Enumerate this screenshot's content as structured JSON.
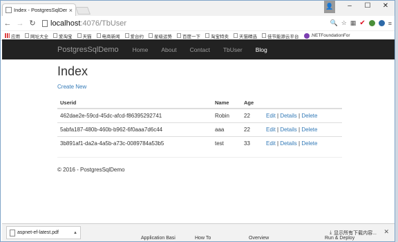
{
  "browser": {
    "tab_title": "Index - PostgresSqlDemo",
    "address_host": "localhost",
    "address_path": ":4076/TbUser",
    "window_controls": {
      "minimize": "–",
      "maximize": "☐",
      "close": "✕"
    },
    "bookmarks": [
      "应用",
      "网址大全",
      "爱淘宝",
      "天猫",
      "电商新闻",
      "爱台约",
      "星级运势",
      "百度一下",
      "淘宝特卖",
      "天猫精选",
      "佳节能源云平台",
      ".NETFoundationFor"
    ]
  },
  "site": {
    "brand": "PostgresSqlDemo",
    "nav": [
      "Home",
      "About",
      "Contact",
      "TbUser",
      "Blog"
    ],
    "active_nav": "Blog"
  },
  "main": {
    "heading": "Index",
    "create_link": "Create New",
    "table": {
      "headers": [
        "Userid",
        "Name",
        "Age",
        ""
      ],
      "rows": [
        {
          "id": "462dae2e-59cd-45dc-afcd-f86395292741",
          "name": "Robin",
          "age": "22"
        },
        {
          "id": "5abfa187-480b-460b-b962-6f0aaa7d6c44",
          "name": "aaa",
          "age": "22"
        },
        {
          "id": "3b891af1-da2a-4a5b-a73c-0089784a53b5",
          "name": "test",
          "age": "33"
        }
      ],
      "actions": {
        "edit": "Edit",
        "details": "Details",
        "delete": "Delete",
        "separator": "|"
      }
    },
    "footer": "© 2016 - PostgresSqlDemo"
  },
  "downloads": {
    "file": "aspnet-ef-latest.pdf",
    "show_all": "显示所有下载内容..."
  },
  "background": {
    "items": [
      "Application Basi",
      "How To",
      "Overview",
      "Run & Deploy"
    ]
  }
}
